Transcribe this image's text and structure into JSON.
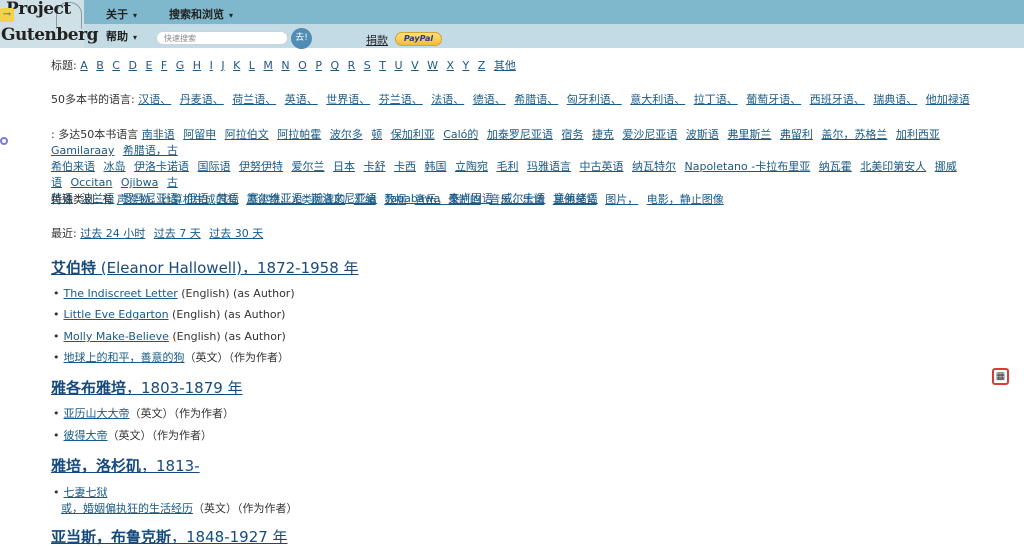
{
  "header": {
    "logo_line1": "Project",
    "logo_line2": "Gutenberg",
    "logo_arrow": "→",
    "nav": [
      {
        "label": "关于",
        "caret": "▾"
      },
      {
        "label": "搜索和浏览",
        "caret": "▾"
      },
      {
        "label": "帮助",
        "caret": "▾"
      }
    ],
    "search_placeholder": "快速搜索",
    "go_label": "去!",
    "donate_label": "捐款",
    "paypal_label": "PayPal"
  },
  "titles": {
    "label": "标题:",
    "letters": [
      "A",
      "B",
      "C",
      "D",
      "E",
      "F",
      "G",
      "H",
      "I",
      "J",
      "K",
      "L",
      "M",
      "N",
      "O",
      "P",
      "Q",
      "R",
      "S",
      "T",
      "U",
      "V",
      "W",
      "X",
      "Y",
      "Z",
      "其他"
    ]
  },
  "languages50": {
    "label": "50多本书的语言:",
    "items": [
      "汉语、",
      "丹麦语、",
      "荷兰语、",
      "英语、",
      "世界语、",
      "芬兰语、",
      "法语、",
      "德语、",
      "希腊语、",
      "匈牙利语、",
      "意大利语、",
      "拉丁语、",
      "葡萄牙语、",
      "西班牙语、",
      "瑞典语、",
      "他加禄语"
    ]
  },
  "languages_lt50": {
    "label": ": 多达50本书语言",
    "line1": [
      "南非语",
      "阿留申",
      "阿拉伯文",
      "阿拉帕霍",
      "波尔多",
      "顿",
      "保加利亚",
      "Caló的",
      "加泰罗尼亚语",
      "宿务",
      "捷克",
      "爱沙尼亚语",
      "波斯语",
      "弗里斯兰",
      "弗留利",
      "盖尔，苏格兰",
      "加利西亚",
      "Gamilaraay",
      "希腊语，古"
    ],
    "line2": [
      "希伯来语",
      "冰岛",
      "伊洛卡诺语",
      "国际语",
      "伊努伊特",
      "爱尔兰",
      "日本",
      "卡舒",
      "卡西",
      "韩国",
      "立陶宛",
      "毛利",
      "玛雅语言",
      "中古英语",
      "纳瓦特尔",
      "Napoletano -卡拉布里亚",
      "纳瓦霍",
      "北美印第安人",
      "挪威语",
      "Occitan",
      "Ojibwa",
      "古"
    ],
    "line3": [
      "英语",
      "波兰语",
      "罗马尼亚语",
      "俄语",
      "梵语",
      "塞尔维亚语",
      "斯洛文尼亚语",
      "Tagabawa",
      "泰卢固语",
      "威尔士语",
      "意第绪语"
    ]
  },
  "special": {
    "label": "特殊类别: 有",
    "items": [
      "声读物，计算机生成的有",
      "声读物，人类阅读的",
      "汇编",
      "数据",
      "音乐，录制的",
      "音乐，乐谱",
      "其他录音",
      "图片，",
      "电影，静止图像"
    ]
  },
  "recent": {
    "label": "最近:",
    "items": [
      "过去 24 小时",
      "过去 7 天",
      "过去 30 天"
    ]
  },
  "authors": [
    {
      "heading_cn": "艾伯特",
      "heading_latin": " (Eleanor Hallowell)",
      "heading_dates": "，1872-1958 年",
      "books": [
        {
          "title": "The Indiscreet Letter",
          "meta": " (English) (as Author)"
        },
        {
          "title": "Little Eve Edgarton",
          "meta": " (English) (as Author)"
        },
        {
          "title": "Molly Make-Believe",
          "meta": " (English) (as Author)"
        },
        {
          "title": "地球上的和平，善意的狗",
          "meta": "（英文）（作为作者）"
        }
      ]
    },
    {
      "heading_cn": "雅各布雅培",
      "heading_latin": "",
      "heading_dates": "，1803-1879 年",
      "books": [
        {
          "title": "亚历山大大帝",
          "meta": "（英文）（作为作者）"
        },
        {
          "title": "彼得大帝",
          "meta": "（英文）（作为作者）"
        }
      ]
    },
    {
      "heading_cn": "雅培，洛杉矶",
      "heading_latin": "",
      "heading_dates": "，1813-",
      "books": [
        {
          "title": "七妻七狱",
          "title2": "或，婚姻偏执狂的生活经历",
          "meta": "（英文）（作为作者）"
        }
      ]
    },
    {
      "heading_cn": "亚当斯，布鲁克斯",
      "heading_latin": "",
      "heading_dates": "，1848-1927 年",
      "books": []
    }
  ],
  "bullet": "•",
  "qr_icon": "▦"
}
